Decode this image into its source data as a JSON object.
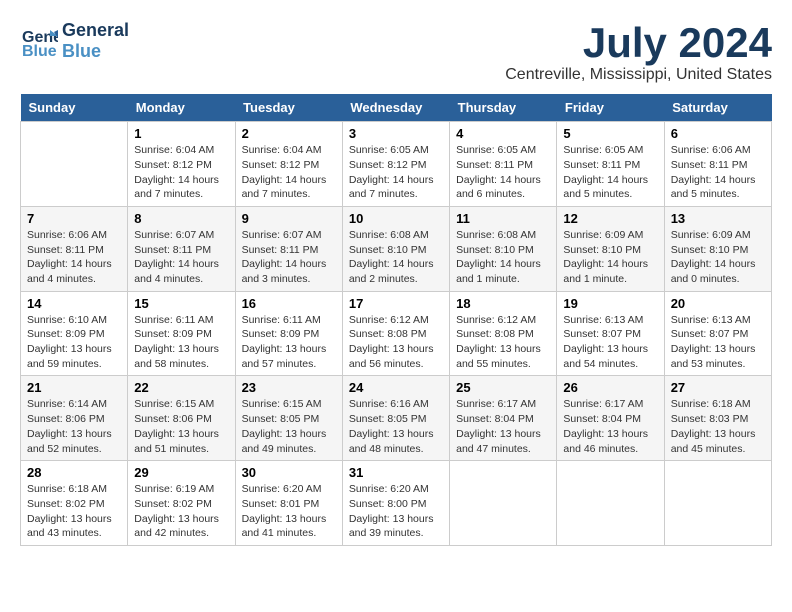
{
  "header": {
    "logo_line1": "General",
    "logo_line2": "Blue",
    "month": "July 2024",
    "location": "Centreville, Mississippi, United States"
  },
  "weekdays": [
    "Sunday",
    "Monday",
    "Tuesday",
    "Wednesday",
    "Thursday",
    "Friday",
    "Saturday"
  ],
  "weeks": [
    [
      {
        "day": "",
        "info": ""
      },
      {
        "day": "1",
        "info": "Sunrise: 6:04 AM\nSunset: 8:12 PM\nDaylight: 14 hours\nand 7 minutes."
      },
      {
        "day": "2",
        "info": "Sunrise: 6:04 AM\nSunset: 8:12 PM\nDaylight: 14 hours\nand 7 minutes."
      },
      {
        "day": "3",
        "info": "Sunrise: 6:05 AM\nSunset: 8:12 PM\nDaylight: 14 hours\nand 7 minutes."
      },
      {
        "day": "4",
        "info": "Sunrise: 6:05 AM\nSunset: 8:11 PM\nDaylight: 14 hours\nand 6 minutes."
      },
      {
        "day": "5",
        "info": "Sunrise: 6:05 AM\nSunset: 8:11 PM\nDaylight: 14 hours\nand 5 minutes."
      },
      {
        "day": "6",
        "info": "Sunrise: 6:06 AM\nSunset: 8:11 PM\nDaylight: 14 hours\nand 5 minutes."
      }
    ],
    [
      {
        "day": "7",
        "info": "Sunrise: 6:06 AM\nSunset: 8:11 PM\nDaylight: 14 hours\nand 4 minutes."
      },
      {
        "day": "8",
        "info": "Sunrise: 6:07 AM\nSunset: 8:11 PM\nDaylight: 14 hours\nand 4 minutes."
      },
      {
        "day": "9",
        "info": "Sunrise: 6:07 AM\nSunset: 8:11 PM\nDaylight: 14 hours\nand 3 minutes."
      },
      {
        "day": "10",
        "info": "Sunrise: 6:08 AM\nSunset: 8:10 PM\nDaylight: 14 hours\nand 2 minutes."
      },
      {
        "day": "11",
        "info": "Sunrise: 6:08 AM\nSunset: 8:10 PM\nDaylight: 14 hours\nand 1 minute."
      },
      {
        "day": "12",
        "info": "Sunrise: 6:09 AM\nSunset: 8:10 PM\nDaylight: 14 hours\nand 1 minute."
      },
      {
        "day": "13",
        "info": "Sunrise: 6:09 AM\nSunset: 8:10 PM\nDaylight: 14 hours\nand 0 minutes."
      }
    ],
    [
      {
        "day": "14",
        "info": "Sunrise: 6:10 AM\nSunset: 8:09 PM\nDaylight: 13 hours\nand 59 minutes."
      },
      {
        "day": "15",
        "info": "Sunrise: 6:11 AM\nSunset: 8:09 PM\nDaylight: 13 hours\nand 58 minutes."
      },
      {
        "day": "16",
        "info": "Sunrise: 6:11 AM\nSunset: 8:09 PM\nDaylight: 13 hours\nand 57 minutes."
      },
      {
        "day": "17",
        "info": "Sunrise: 6:12 AM\nSunset: 8:08 PM\nDaylight: 13 hours\nand 56 minutes."
      },
      {
        "day": "18",
        "info": "Sunrise: 6:12 AM\nSunset: 8:08 PM\nDaylight: 13 hours\nand 55 minutes."
      },
      {
        "day": "19",
        "info": "Sunrise: 6:13 AM\nSunset: 8:07 PM\nDaylight: 13 hours\nand 54 minutes."
      },
      {
        "day": "20",
        "info": "Sunrise: 6:13 AM\nSunset: 8:07 PM\nDaylight: 13 hours\nand 53 minutes."
      }
    ],
    [
      {
        "day": "21",
        "info": "Sunrise: 6:14 AM\nSunset: 8:06 PM\nDaylight: 13 hours\nand 52 minutes."
      },
      {
        "day": "22",
        "info": "Sunrise: 6:15 AM\nSunset: 8:06 PM\nDaylight: 13 hours\nand 51 minutes."
      },
      {
        "day": "23",
        "info": "Sunrise: 6:15 AM\nSunset: 8:05 PM\nDaylight: 13 hours\nand 49 minutes."
      },
      {
        "day": "24",
        "info": "Sunrise: 6:16 AM\nSunset: 8:05 PM\nDaylight: 13 hours\nand 48 minutes."
      },
      {
        "day": "25",
        "info": "Sunrise: 6:17 AM\nSunset: 8:04 PM\nDaylight: 13 hours\nand 47 minutes."
      },
      {
        "day": "26",
        "info": "Sunrise: 6:17 AM\nSunset: 8:04 PM\nDaylight: 13 hours\nand 46 minutes."
      },
      {
        "day": "27",
        "info": "Sunrise: 6:18 AM\nSunset: 8:03 PM\nDaylight: 13 hours\nand 45 minutes."
      }
    ],
    [
      {
        "day": "28",
        "info": "Sunrise: 6:18 AM\nSunset: 8:02 PM\nDaylight: 13 hours\nand 43 minutes."
      },
      {
        "day": "29",
        "info": "Sunrise: 6:19 AM\nSunset: 8:02 PM\nDaylight: 13 hours\nand 42 minutes."
      },
      {
        "day": "30",
        "info": "Sunrise: 6:20 AM\nSunset: 8:01 PM\nDaylight: 13 hours\nand 41 minutes."
      },
      {
        "day": "31",
        "info": "Sunrise: 6:20 AM\nSunset: 8:00 PM\nDaylight: 13 hours\nand 39 minutes."
      },
      {
        "day": "",
        "info": ""
      },
      {
        "day": "",
        "info": ""
      },
      {
        "day": "",
        "info": ""
      }
    ]
  ]
}
